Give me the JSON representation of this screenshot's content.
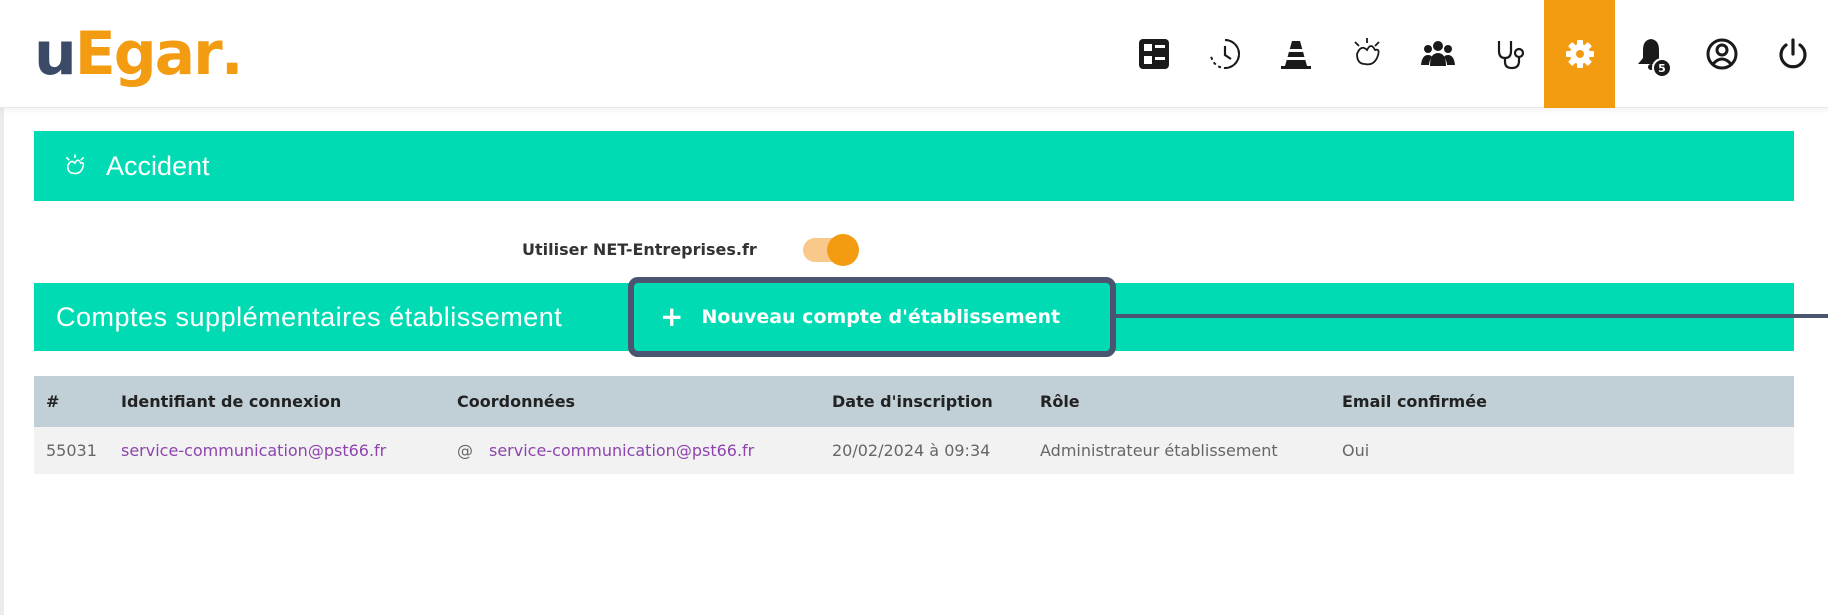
{
  "header": {
    "logo": {
      "u": "u",
      "e": "E",
      "rest": "gar",
      "dot": "."
    },
    "nav": [
      {
        "icon": "dashboard-icon"
      },
      {
        "icon": "history-clock-icon"
      },
      {
        "icon": "traffic-cone-icon"
      },
      {
        "icon": "accident-burst-icon"
      },
      {
        "icon": "users-group-icon"
      },
      {
        "icon": "stethoscope-icon"
      },
      {
        "icon": "gear-icon",
        "active": true
      },
      {
        "icon": "bell-icon",
        "badge": "5"
      },
      {
        "icon": "user-circle-icon"
      },
      {
        "icon": "power-icon"
      }
    ],
    "notification_count": "5"
  },
  "accident_section": {
    "title": "Accident",
    "icon": "accident-burst-icon"
  },
  "net_entreprises": {
    "label": "Utiliser NET-Entreprises.fr",
    "enabled": true
  },
  "comptes_section": {
    "title": "Comptes supplémentaires établissement",
    "new_button": {
      "plus": "+",
      "label": "Nouveau compte d'établissement"
    }
  },
  "table": {
    "headers": [
      "#",
      "Identifiant de connexion",
      "Coordonnées",
      "Date d'inscription",
      "Rôle",
      "Email confirmée"
    ],
    "rows": [
      {
        "id": "55031",
        "login": "service-communication@pst66.fr",
        "contact_prefix": "@",
        "contact": "service-communication@pst66.fr",
        "date": "20/02/2024 à 09:34",
        "role": "Administrateur établissement",
        "email_confirmed": "Oui"
      }
    ]
  },
  "colors": {
    "accent": "#f39c12",
    "teal": "#00dbb4",
    "header_row": "#c1cfd6",
    "link": "#8e44ad",
    "callout": "#4a5670"
  }
}
